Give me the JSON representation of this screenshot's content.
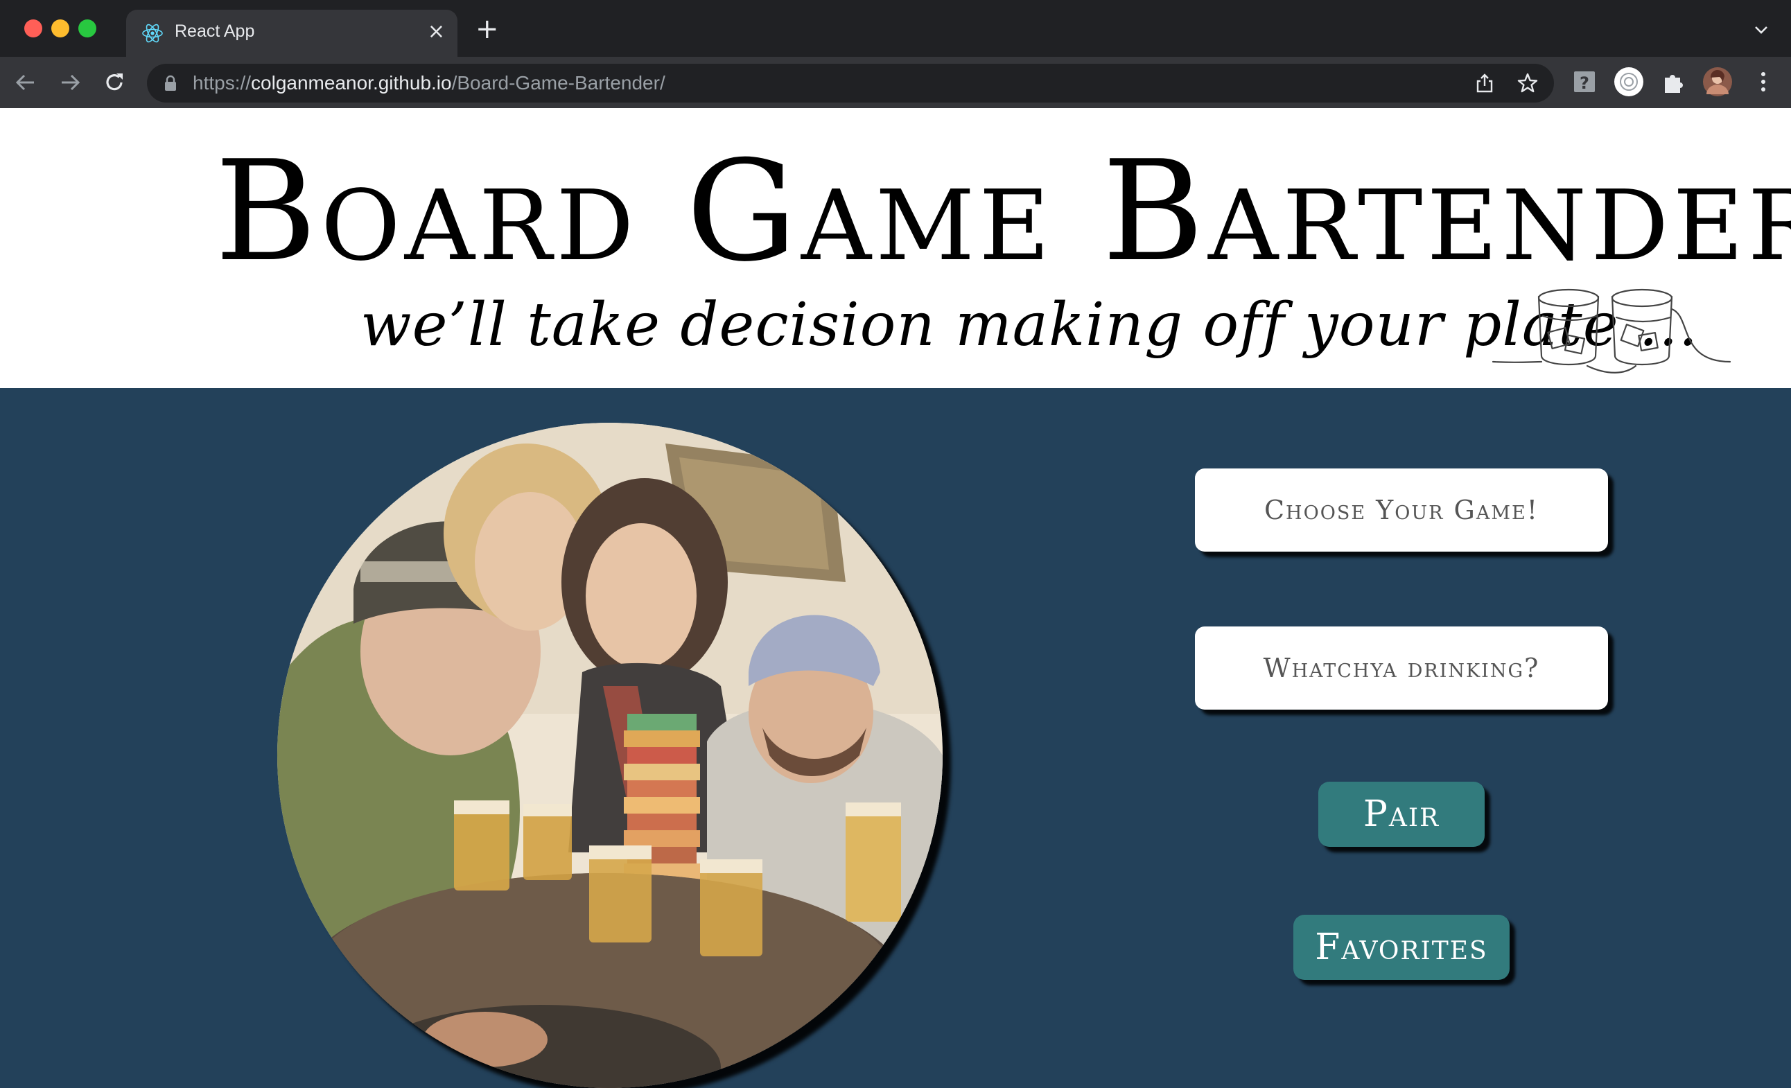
{
  "browser": {
    "tab_title": "React App",
    "tab_close": "×",
    "new_tab": "+",
    "url_scheme": "https://",
    "url_host": "colganmeanor.github.io",
    "url_path": "/Board-Game-Bartender/"
  },
  "header": {
    "title": "Board Game Bartender",
    "tagline": "we’ll take decision making off your plate …"
  },
  "form": {
    "game_select": "Choose Your Game!",
    "drink_select": "Whatchya drinking?",
    "pair_button": "Pair",
    "favorites_button": "Favorites"
  },
  "colors": {
    "page_background": "#23415a",
    "button": "#327b7d",
    "header_background": "#ffffff"
  }
}
